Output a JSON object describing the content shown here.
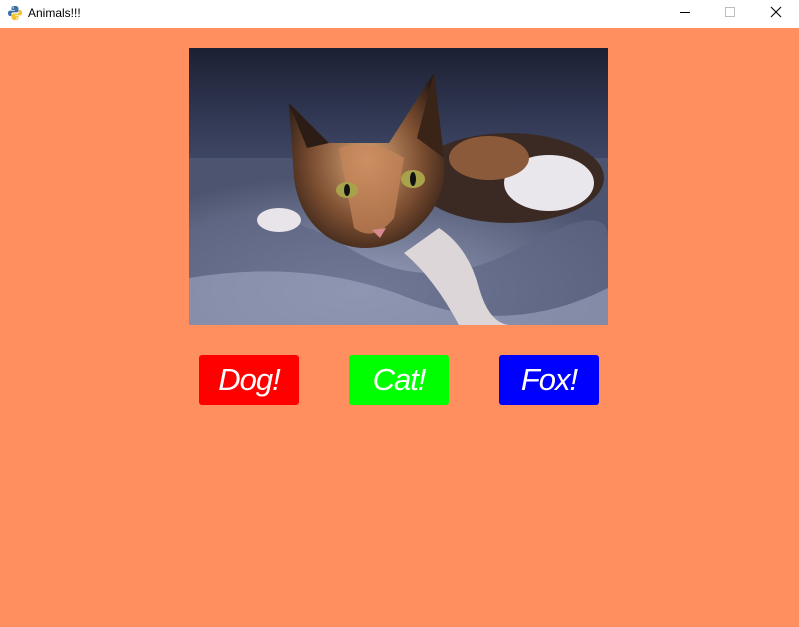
{
  "window": {
    "title": "Animals!!!",
    "minimize_icon": "minimize-icon",
    "maximize_icon": "maximize-icon",
    "close_icon": "close-icon",
    "app_icon": "python-icon"
  },
  "main": {
    "background": "#ff8f5f",
    "image": {
      "subject": "cat-photo"
    },
    "buttons": [
      {
        "label": "Dog!",
        "color": "#ff0000"
      },
      {
        "label": "Cat!",
        "color": "#00ff00"
      },
      {
        "label": "Fox!",
        "color": "#0000ff"
      }
    ]
  }
}
